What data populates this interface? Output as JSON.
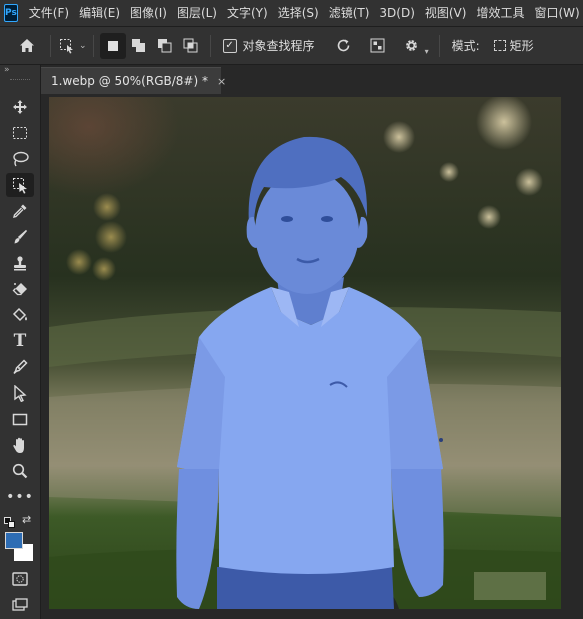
{
  "app": {
    "logo": "Ps"
  },
  "menu": [
    "文件(F)",
    "编辑(E)",
    "图像(I)",
    "图层(L)",
    "文字(Y)",
    "选择(S)",
    "滤镜(T)",
    "3D(D)",
    "视图(V)",
    "增效工具",
    "窗口(W)"
  ],
  "options": {
    "checkbox_label": "对象查找程序",
    "checkbox_checked": true,
    "mode_label": "模式:",
    "mode_value": "矩形"
  },
  "document": {
    "tab_title": "1.webp @ 50%(RGB/8#) *",
    "close_glyph": "×"
  },
  "colors": {
    "foreground": "#2e6db4",
    "background": "#ffffff",
    "selection_overlay": "#6f93e6"
  },
  "toolbar_icons": [
    "move-icon",
    "marquee-icon",
    "lasso-icon",
    "object-selection-icon",
    "eyedropper-icon",
    "brush-icon",
    "stamp-icon",
    "eraser-icon",
    "paint-bucket-icon",
    "type-icon",
    "pen-icon",
    "path-selection-icon",
    "rectangle-icon",
    "hand-icon",
    "zoom-icon",
    "more-tools-icon"
  ]
}
